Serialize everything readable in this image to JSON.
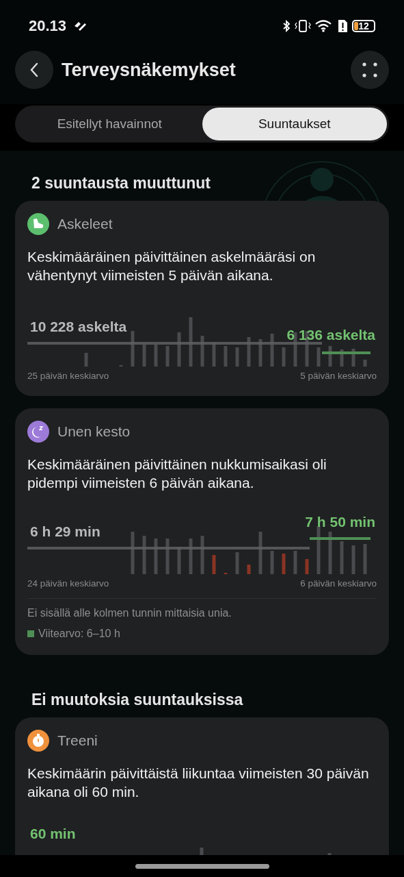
{
  "status_bar": {
    "time": "20.13",
    "battery": "12"
  },
  "header": {
    "title": "Terveysnäkemykset"
  },
  "tabs": [
    {
      "label": "Esitellyt havainnot",
      "selected": false
    },
    {
      "label": "Suuntaukset",
      "selected": true
    }
  ],
  "sections": [
    {
      "title": "2 suuntausta muuttunut",
      "cards": [
        {
          "kind": "steps",
          "title": "Askeleet",
          "description": "Keskimääräinen päivittäinen askelmääräsi on vähentynyt viimeisten 5 päivän aikana.",
          "left_value": "10 228 askelta",
          "left_caption": "25 päivän keskiarvo",
          "right_value": "6 136 askelta",
          "right_caption": "5 päivän keskiarvo"
        },
        {
          "kind": "sleep",
          "title": "Unen kesto",
          "description": "Keskimääräinen päivittäinen nukkumisaikasi oli pidempi viimeisten 6 päivän aikana.",
          "left_value": "6 h 29 min",
          "left_caption": "24 päivän keskiarvo",
          "right_value": "7 h 50 min",
          "right_caption": "6 päivän keskiarvo",
          "note": "Ei sisällä alle kolmen tunnin mittaisia unia.",
          "legend": "Viitearvo: 6–10 h"
        }
      ]
    },
    {
      "title": "Ei muutoksia suuntauksissa",
      "cards": [
        {
          "kind": "workout",
          "title": "Treeni",
          "description": "Keskimäärin päivittäistä liikuntaa viimeisten 30 päivän aikana oli 60 min.",
          "right_value": "60 min"
        }
      ]
    }
  ]
}
